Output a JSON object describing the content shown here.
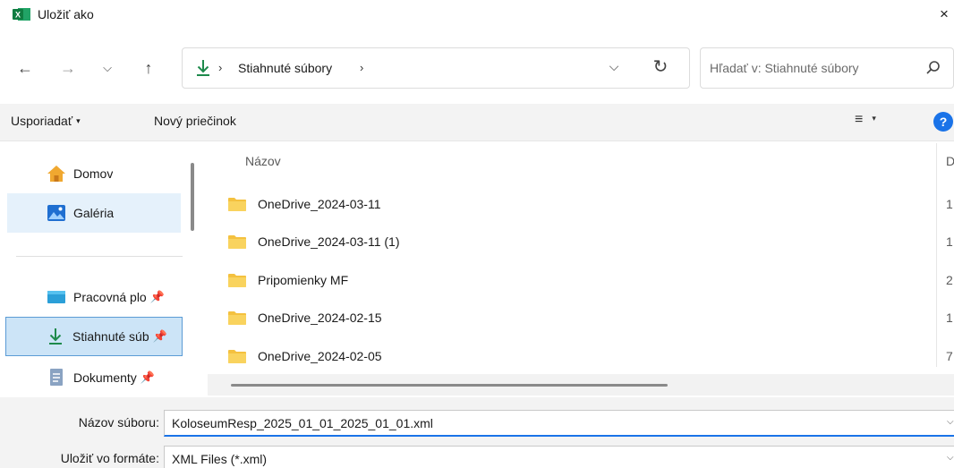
{
  "window": {
    "title": "Uložiť ako",
    "close": "×"
  },
  "nav": {
    "back": "←",
    "forward": "→",
    "recent": "⌵",
    "up": "↑",
    "breadcrumb_sep": "›",
    "path": "Stiahnuté súbory",
    "dropdown": "⌵",
    "refresh": "↻"
  },
  "search": {
    "placeholder": "Hľadať v: Stiahnuté súbory"
  },
  "toolbar": {
    "organize": "Usporiadať",
    "new_folder": "Nový priečinok",
    "view": "≡",
    "caret": "▾",
    "help": "?"
  },
  "sidebar": {
    "items": [
      {
        "label": "Domov",
        "icon": "home-icon"
      },
      {
        "label": "Galéria",
        "icon": "gallery-icon"
      },
      {
        "label": "Pracovná plo",
        "icon": "desktop-icon",
        "pinned": true
      },
      {
        "label": "Stiahnuté súb",
        "icon": "download-icon",
        "pinned": true
      },
      {
        "label": "Dokumenty",
        "icon": "documents-icon",
        "pinned": true
      }
    ],
    "pin_glyph": "📌"
  },
  "files": {
    "columns": {
      "name": "Názov",
      "date": "D"
    },
    "rows": [
      {
        "name": "OneDrive_2024-03-11",
        "date": "1"
      },
      {
        "name": "OneDrive_2024-03-11 (1)",
        "date": "1"
      },
      {
        "name": "Pripomienky MF",
        "date": "2"
      },
      {
        "name": "OneDrive_2024-02-15",
        "date": "1"
      },
      {
        "name": "OneDrive_2024-02-05",
        "date": "7"
      }
    ]
  },
  "save": {
    "filename_label": "Názov súboru:",
    "filename_value": "KoloseumResp_2025_01_01_2025_01_01.xml",
    "format_label": "Uložiť vo formáte:",
    "format_value": "XML Files (*.xml)",
    "caret": "⌵"
  },
  "colors": {
    "accent": "#1a73e8",
    "folder": "#f4c13f",
    "selection": "#cce4f7",
    "hover": "#e5f1fb",
    "excel_green": "#107c41"
  }
}
